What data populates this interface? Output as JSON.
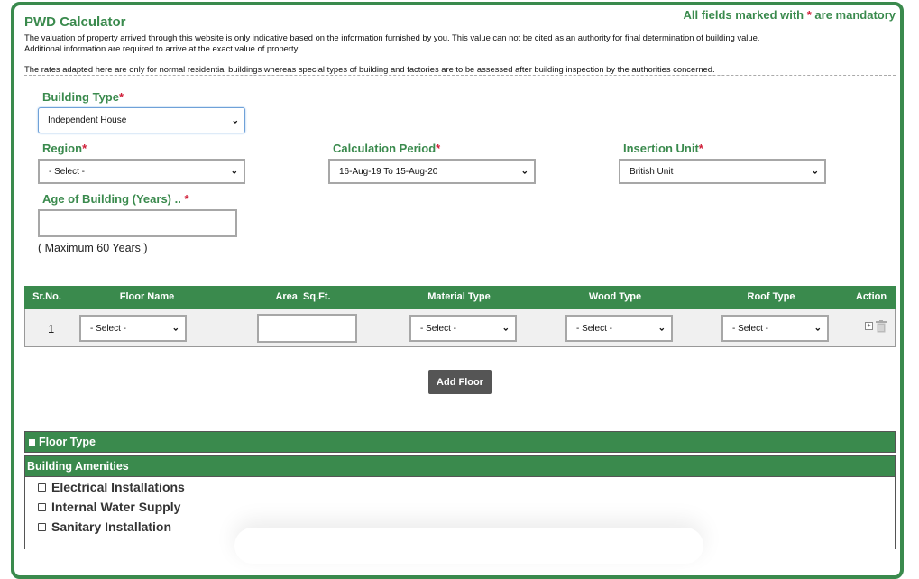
{
  "header": {
    "title": "PWD Calculator",
    "mandatory_note_pre": "All fields marked with ",
    "mandatory_star": "*",
    "mandatory_note_post": " are mandatory",
    "disclaimer1": "The valuation of property arrived through this website is only indicative based on the information furnished by you. This value can not be cited as an authority for final determination of building value. Additional information are required to arrive at the exact value of property.",
    "disclaimer2": "The rates adapted here are only for normal residential buildings whereas special types of building and factories are to be assessed after building inspection by the authorities concerned."
  },
  "form": {
    "building_type": {
      "label": "Building Type",
      "value": "Independent House"
    },
    "region": {
      "label": "Region",
      "value": "- Select -"
    },
    "calculation_period": {
      "label": "Calculation Period",
      "value": "16-Aug-19 To 15-Aug-20"
    },
    "insertion_unit": {
      "label": "Insertion Unit",
      "value": "British Unit"
    },
    "age": {
      "label": "Age of Building (Years) .. ",
      "value": "",
      "note": "( Maximum 60 Years )"
    },
    "star": "*"
  },
  "floor_table": {
    "headers": [
      "Sr.No.",
      "Floor Name",
      "Area  Sq.Ft.",
      "Material Type",
      "Wood Type",
      "Roof Type",
      "Action"
    ],
    "rows": [
      {
        "sr": "1",
        "floor_name": "- Select -",
        "area": "",
        "material": "- Select -",
        "wood": "- Select -",
        "roof": "- Select -"
      }
    ]
  },
  "add_floor_label": "Add Floor",
  "floor_type_label": "Floor Type",
  "amenities": {
    "title": "Building Amenities",
    "items": [
      "Electrical Installations",
      "Internal Water Supply",
      "Sanitary Installation"
    ]
  },
  "colors": {
    "accent": "#3a8a4d",
    "required": "#d0203a",
    "button": "#555555"
  }
}
